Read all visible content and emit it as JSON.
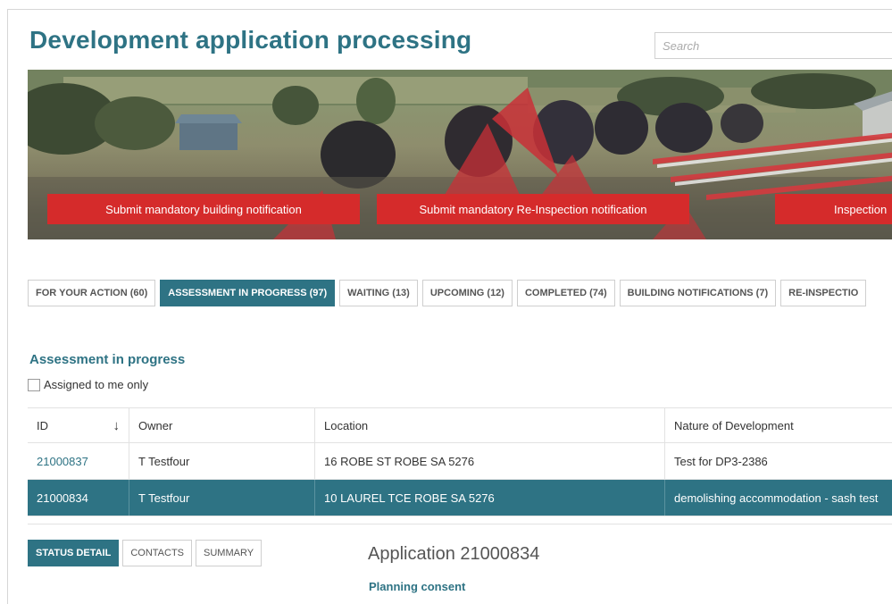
{
  "page": {
    "title": "Development application processing"
  },
  "search": {
    "placeholder": "Search"
  },
  "banner": {
    "buttons": [
      "Submit mandatory building notification",
      "Submit mandatory Re-Inspection notification",
      "Inspection"
    ]
  },
  "tabs": [
    {
      "label": "FOR YOUR ACTION (60)",
      "active": false
    },
    {
      "label": "ASSESSMENT IN PROGRESS (97)",
      "active": true
    },
    {
      "label": "WAITING (13)",
      "active": false
    },
    {
      "label": "UPCOMING (12)",
      "active": false
    },
    {
      "label": "COMPLETED (74)",
      "active": false
    },
    {
      "label": "BUILDING NOTIFICATIONS (7)",
      "active": false
    },
    {
      "label": "RE-INSPECTIO",
      "active": false
    }
  ],
  "section": {
    "title": "Assessment in progress",
    "assigned_label": "Assigned to me only",
    "assigned_checked": false
  },
  "table": {
    "columns": [
      "ID",
      "Owner",
      "Location",
      "Nature of Development"
    ],
    "rows": [
      {
        "id": "21000837",
        "owner": "T Testfour",
        "location": "16 ROBE ST ROBE SA 5276",
        "nature": "Test for DP3-2386",
        "selected": false
      },
      {
        "id": "21000834",
        "owner": "T Testfour",
        "location": "10 LAUREL TCE ROBE SA 5276",
        "nature": "demolishing accommodation - sash test",
        "selected": true
      }
    ]
  },
  "detail_tabs": [
    {
      "label": "STATUS DETAIL",
      "active": true
    },
    {
      "label": "CONTACTS",
      "active": false
    },
    {
      "label": "SUMMARY",
      "active": false
    }
  ],
  "application": {
    "title": "Application 21000834",
    "subtitle": "Planning consent"
  },
  "icons": {
    "sort": "arrow-down-icon"
  },
  "colors": {
    "accent": "#2e7384",
    "banner_button": "#d52b2b"
  }
}
